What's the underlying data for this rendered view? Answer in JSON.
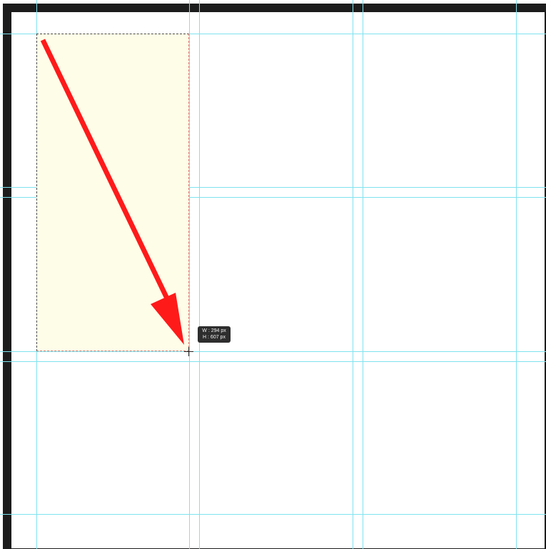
{
  "canvas": {
    "frame_color": "#1c1c1c",
    "guide_color": "#7fe3f0",
    "selection_fill": "#fdfde8",
    "arrow_color": "#ff1a1a"
  },
  "tooltip": {
    "width_label": "W : 294 px",
    "height_label": "H : 607 px"
  },
  "icons": {
    "cursor": "crosshair-icon",
    "annotation": "arrow-icon"
  }
}
